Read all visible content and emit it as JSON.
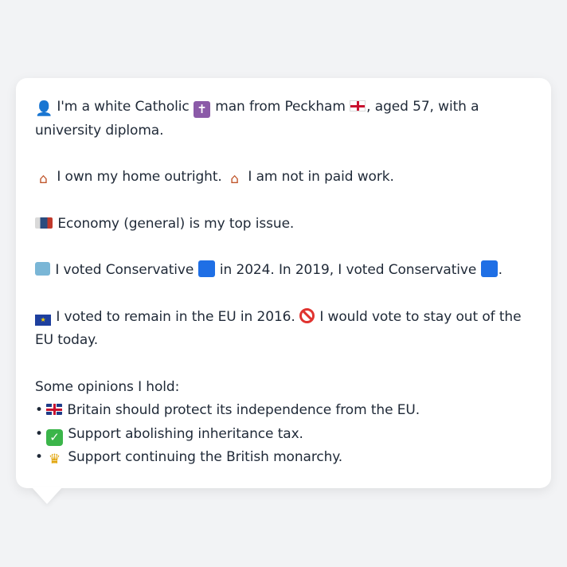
{
  "profile": {
    "intro": {
      "person_icon": "👤",
      "t1": "I'm a white Catholic",
      "cross_icon": "✝",
      "t2": "man from Peckham",
      "t3": ", aged 57, with a university diploma."
    },
    "home": {
      "t1": "I own my home outright.",
      "t2": "I am not in paid work."
    },
    "issue": {
      "text": "Economy (general) is my top issue."
    },
    "votes": {
      "t1": "I voted Conservative",
      "t2": "in 2024. In 2019, I voted Conservative",
      "t3": "."
    },
    "eu": {
      "t1": "I voted to remain in the EU in 2016.",
      "t2": "I would vote to stay out of the EU today."
    },
    "opinions": {
      "heading": "Some opinions I hold:",
      "bullet": "•",
      "items": [
        {
          "icon": "uk-flag-icon",
          "text": "Britain should protect its independence from the EU."
        },
        {
          "icon": "check-mark-icon",
          "check": "✓",
          "text": "Support abolishing inheritance tax."
        },
        {
          "icon": "crown-icon",
          "glyph": "♛",
          "text": "Support continuing the British monarchy."
        }
      ]
    }
  },
  "icons": {
    "house": "⌂",
    "eu_stars": "★"
  },
  "colors": {
    "background": "#f2f3f5",
    "bubble": "#ffffff",
    "text": "#1f2937",
    "conservative_blue": "#1f6fe5",
    "eu_blue": "#1e3f9e",
    "no_red": "#e0332f",
    "check_green": "#3bb54a"
  }
}
